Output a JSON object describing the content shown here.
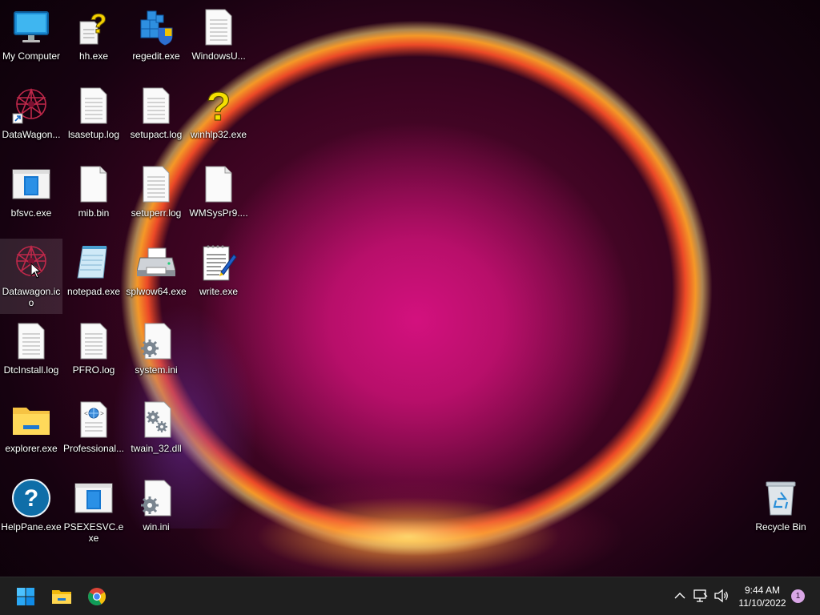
{
  "desktop": {
    "icons": [
      {
        "label": "My Computer",
        "icon": "monitor-icon"
      },
      {
        "label": "hh.exe",
        "icon": "help-file-icon"
      },
      {
        "label": "regedit.exe",
        "icon": "registry-editor-icon"
      },
      {
        "label": "WindowsU...",
        "icon": "document-icon"
      },
      {
        "label": "DataWagon...",
        "icon": "datawagon-shortcut-icon"
      },
      {
        "label": "lsasetup.log",
        "icon": "text-file-icon"
      },
      {
        "label": "setupact.log",
        "icon": "text-file-icon"
      },
      {
        "label": "winhlp32.exe",
        "icon": "question-mark-icon"
      },
      {
        "label": "bfsvc.exe",
        "icon": "app-window-icon"
      },
      {
        "label": "mib.bin",
        "icon": "blank-file-icon"
      },
      {
        "label": "setuperr.log",
        "icon": "text-file-icon"
      },
      {
        "label": "WMSysPr9....",
        "icon": "blank-file-icon"
      },
      {
        "label": "Datawagon.ico",
        "icon": "datawagon-icon"
      },
      {
        "label": "notepad.exe",
        "icon": "notepad-icon"
      },
      {
        "label": "splwow64.exe",
        "icon": "printer-icon"
      },
      {
        "label": "write.exe",
        "icon": "wordpad-icon"
      },
      {
        "label": "DtcInstall.log",
        "icon": "text-file-icon"
      },
      {
        "label": "PFRO.log",
        "icon": "text-file-icon"
      },
      {
        "label": "system.ini",
        "icon": "settings-file-icon"
      },
      {
        "label": "explorer.exe",
        "icon": "folder-icon"
      },
      {
        "label": "Professional...",
        "icon": "html-file-icon"
      },
      {
        "label": "twain_32.dll",
        "icon": "dll-file-icon"
      },
      {
        "label": "HelpPane.exe",
        "icon": "help-circle-icon"
      },
      {
        "label": "PSEXESVC.exe",
        "icon": "app-window-icon"
      },
      {
        "label": "win.ini",
        "icon": "settings-file-icon"
      },
      {
        "label": "Recycle Bin",
        "icon": "recycle-bin-icon"
      }
    ],
    "selected": "Datawagon.ico"
  },
  "taskbar": {
    "apps": [
      {
        "name": "Start",
        "icon": "windows-start-icon"
      },
      {
        "name": "File Explorer",
        "icon": "file-explorer-icon"
      },
      {
        "name": "Google Chrome",
        "icon": "chrome-icon"
      }
    ],
    "tray": {
      "overflow_icon": "chevron-up-icon",
      "network_icon": "network-icon",
      "volume_icon": "volume-icon",
      "time": "9:44 AM",
      "date": "11/10/2022",
      "notification_count": "1"
    }
  },
  "colors": {
    "taskbar_bg": "#1f1f1f",
    "accent_blue": "#0078d4"
  }
}
